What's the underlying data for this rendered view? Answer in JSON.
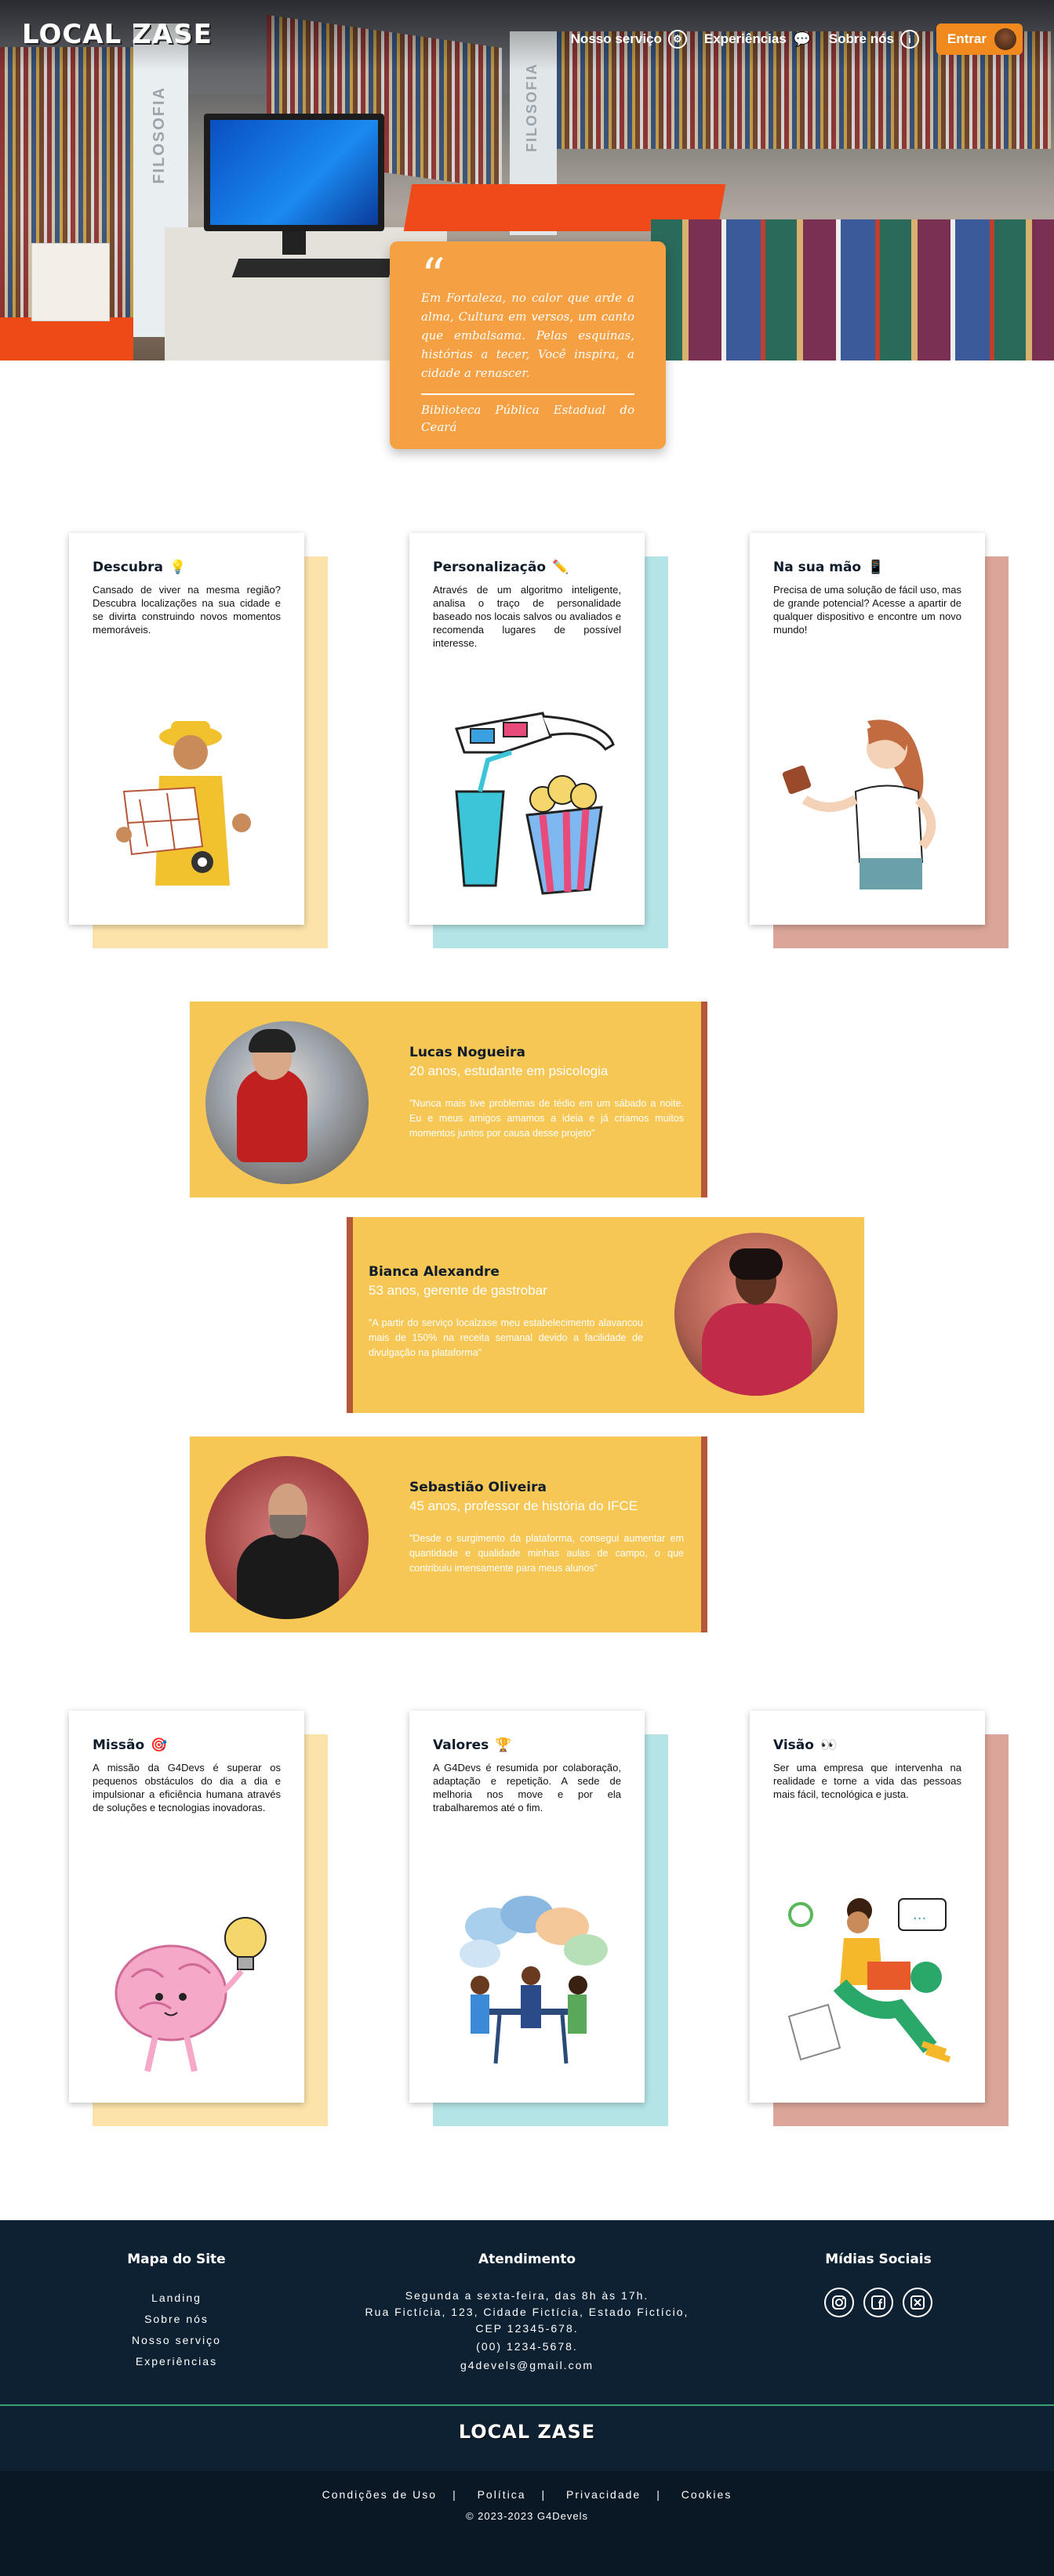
{
  "brand": {
    "logo": "LOCAL ZASE"
  },
  "nav": {
    "items": [
      {
        "label": "Nosso serviço",
        "icon": "gear-icon"
      },
      {
        "label": "Experiências",
        "icon": "chat-icon"
      },
      {
        "label": "Sobre nós",
        "icon": "info-icon"
      }
    ],
    "login_label": "Entrar"
  },
  "hero": {
    "signs": [
      "FILOSOFIA",
      "FILOSOFIA"
    ],
    "quote": "Em Fortaleza, no calor que arde a alma, Cultura em versos, um canto que embalsama. Pelas esquinas, histórias a tecer, Você inspira, a cidade a renascer.",
    "source": "Biblioteca Pública Estadual do Ceará"
  },
  "features": [
    {
      "title": "Descubra",
      "emoji": "💡",
      "text": "Cansado de viver na mesma região? Descubra localizações na sua cidade e se divirta construindo novos momentos memoráveis.",
      "shadow": "#fbe3a9"
    },
    {
      "title": "Personalização",
      "emoji": "✏️",
      "text": "Através de um algoritmo inteligente, analisa o traço de personalidade baseado nos locais salvos ou avaliados e recomenda lugares de possível interesse.",
      "shadow": "#b4e4e6"
    },
    {
      "title": "Na sua mão",
      "emoji": "📱",
      "text": "Precisa de uma solução de fácil uso, mas de grande potencial? Acesse a apartir de qualquer dispositivo e encontre um novo mundo!",
      "shadow": "#dba599"
    }
  ],
  "testimonials": [
    {
      "name": "Lucas Nogueira",
      "role": "20 anos, estudante em psicologia",
      "message": "\"Nunca mais tive problemas de tédio em um sábado a noite. Eu e meus amigos amamos a ideia e já criamos muitos momentos juntos por causa desse projeto\""
    },
    {
      "name": "Bianca Alexandre",
      "role": "53 anos, gerente de gastrobar",
      "message": "\"A partir do serviço localzase meu estabelecimento alavancou mais de 150% na receita semanal devido a facilidade de divulgação na plataforma\""
    },
    {
      "name": "Sebastião Oliveira",
      "role": "45 anos, professor de história do IFCE",
      "message": "\"Desde o surgimento da plataforma, consegui aumentar em quantidade e qualidade minhas aulas de campo, o que contribuiu imensamente para meus alunos\""
    }
  ],
  "values": [
    {
      "title": "Missão",
      "emoji": "🎯",
      "text": "A missão da G4Devs é superar os pequenos obstáculos do dia a dia e impulsionar a eficiência humana através de soluções e tecnologias inovadoras.",
      "shadow": "#fbe3a9"
    },
    {
      "title": "Valores",
      "emoji": "🏆",
      "text": "A G4Devs é resumida por colaboração, adaptação e repetição. A sede de melhoria nos move e por ela trabalharemos até o fim.",
      "shadow": "#b4e4e6"
    },
    {
      "title": "Visão",
      "emoji": "👀",
      "text": "Ser uma empresa que intervenha na realidade e torne a vida das pessoas mais fácil, tecnológica e justa.",
      "shadow": "#dba599"
    }
  ],
  "footer": {
    "sitemap_title": "Mapa do Site",
    "sitemap": [
      "Landing",
      "Sobre nós",
      "Nosso serviço",
      "Experiências"
    ],
    "service_title": "Atendimento",
    "service_lines": [
      "Segunda a sexta-feira, das 8h às 17h.",
      "Rua Fictícia, 123, Cidade Fictícia, Estado Fictício,",
      "CEP 12345-678.",
      "(00) 1234-5678.",
      "g4devels@gmail.com"
    ],
    "social_title": "Mídias Sociais",
    "social_icons": [
      "instagram-icon",
      "facebook-icon",
      "x-icon"
    ],
    "logo": "LOCAL ZASE",
    "links": [
      "Condições de Uso",
      "Política",
      "Privacidade",
      "Cookies"
    ],
    "separator": "|",
    "copyright": "© 2023-2023 G4Devels"
  }
}
